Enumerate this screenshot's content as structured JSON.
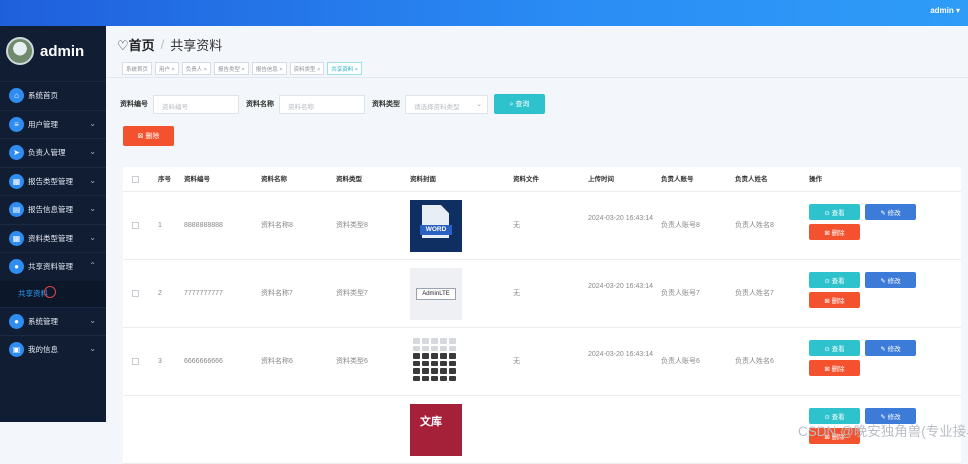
{
  "topbar": {
    "user": "admin ▾"
  },
  "sidebar": {
    "username": "admin",
    "items": [
      {
        "label": "系统首页",
        "icon": "home-icon",
        "glyph": "⌂",
        "chevron": ""
      },
      {
        "label": "用户管理",
        "icon": "sliders-icon",
        "glyph": "≡",
        "chevron": "⌄"
      },
      {
        "label": "负责人管理",
        "icon": "send-icon",
        "glyph": "➤",
        "chevron": "⌄"
      },
      {
        "label": "报告类型管理",
        "icon": "grid-icon",
        "glyph": "▦",
        "chevron": "⌄"
      },
      {
        "label": "报告信息管理",
        "icon": "document-icon",
        "glyph": "▤",
        "chevron": "⌄"
      },
      {
        "label": "资料类型管理",
        "icon": "grid-icon",
        "glyph": "▦",
        "chevron": "⌄"
      },
      {
        "label": "共享资料管理",
        "icon": "user-icon",
        "glyph": "●",
        "chevron": "⌃"
      }
    ],
    "sub_item": "共享资料",
    "items_after": [
      {
        "label": "系统管理",
        "icon": "user-icon",
        "glyph": "●",
        "chevron": "⌄"
      },
      {
        "label": "我的信息",
        "icon": "calendar-icon",
        "glyph": "▣",
        "chevron": "⌄"
      }
    ]
  },
  "breadcrumb": {
    "home": "♡首页",
    "sep": "/",
    "current": "共享资料"
  },
  "tabs": [
    "系统首页",
    "用户 ×",
    "负责人 ×",
    "报告类型 ×",
    "报告信息 ×",
    "资料类型 ×",
    "共享资料 ×"
  ],
  "search": {
    "label1": "资料编号",
    "placeholder1": "资料编号",
    "label2": "资料名称",
    "placeholder2": "资料名称",
    "label3": "资料类型",
    "placeholder3": "请选择资料类型",
    "button": "⌕ 查询"
  },
  "delete_button": "⊠ 删除",
  "table": {
    "headers": [
      "序号",
      "资料编号",
      "资料名称",
      "资料类型",
      "资料封面",
      "资料文件",
      "上传时间",
      "负责人账号",
      "负责人姓名",
      "操作"
    ],
    "rows": [
      {
        "no": "1",
        "code": "8888888888",
        "name": "资料名称8",
        "type": "资料类型8",
        "cover": "word",
        "cover_text": "WORD",
        "file": "无",
        "time": "2024-03-20 16:43:14",
        "acct": "负责人账号8",
        "person": "负责人姓名8"
      },
      {
        "no": "2",
        "code": "7777777777",
        "name": "资料名称7",
        "type": "资料类型7",
        "cover": "adminlte",
        "cover_text": "AdminLTE",
        "file": "无",
        "time": "2024-03-20 16:43:14",
        "acct": "负责人账号7",
        "person": "负责人姓名7"
      },
      {
        "no": "3",
        "code": "6666666666",
        "name": "资料名称6",
        "type": "资料类型6",
        "cover": "calc",
        "cover_text": "",
        "file": "无",
        "time": "2024-03-20 16:43:14",
        "acct": "负责人账号6",
        "person": "负责人姓名6"
      },
      {
        "no": "",
        "code": "",
        "name": "",
        "type": "",
        "cover": "book",
        "cover_text": "文库",
        "file": "",
        "time": "",
        "acct": "",
        "person": ""
      }
    ],
    "op_view": "⊙ 查看",
    "op_edit": "✎ 修改",
    "op_delete": "⊠ 删除"
  },
  "watermark": "CSDN @晚安独角兽(专业接毕设)"
}
